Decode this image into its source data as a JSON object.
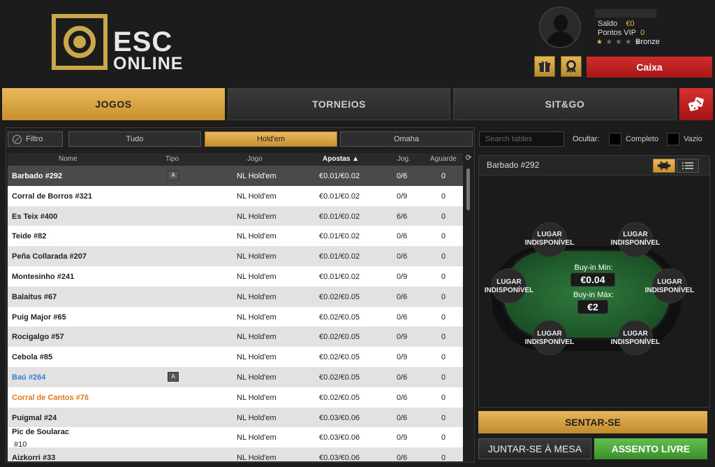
{
  "brand": {
    "line1": "ESC",
    "line2": "ONLINE"
  },
  "account": {
    "saldo_label": "Saldo",
    "saldo_value": "€0",
    "pontos_label": "Pontos VIP",
    "pontos_value": "0",
    "stars": "★ ★ ★ ★ ★",
    "tier": "Bronze",
    "caixa_label": "Caixa",
    "gift_icon": "gift-icon",
    "badge_icon": "vip-badge-icon"
  },
  "tabs": [
    {
      "label": "JOGOS"
    },
    {
      "label": "TORNEIOS"
    },
    {
      "label": "SIT&GO"
    }
  ],
  "filters": {
    "filtro_label": "Filtro",
    "types": [
      "Tudo",
      "Hold'em",
      "Omaha"
    ],
    "active_type": "Hold'em",
    "search_placeholder": "Search tables",
    "ocultar_label": "Ocultar:",
    "completo_label": "Completo",
    "vazio_label": "Vazio"
  },
  "table_list": {
    "headers": {
      "nome": "Nome",
      "tipo": "Tipo",
      "jogo": "Jogo",
      "apostas": "Apostas ▲",
      "jog": "Jog.",
      "aguarde": "Aguarde"
    },
    "rows": [
      {
        "nome": "Barbado #292",
        "locked": true,
        "jogo": "NL Hold'em",
        "apostas": "€0.01/€0.02",
        "jog": "0/6",
        "aguarde": "0",
        "selected": true
      },
      {
        "nome": "Corral de Borros #321",
        "locked": false,
        "jogo": "NL Hold'em",
        "apostas": "€0.01/€0.02",
        "jog": "0/9",
        "aguarde": "0"
      },
      {
        "nome": "Es Teix #400",
        "locked": false,
        "jogo": "NL Hold'em",
        "apostas": "€0.01/€0.02",
        "jog": "6/6",
        "aguarde": "0"
      },
      {
        "nome": "Teide #82",
        "locked": false,
        "jogo": "NL Hold'em",
        "apostas": "€0.01/€0.02",
        "jog": "0/6",
        "aguarde": "0"
      },
      {
        "nome": "Peña Collarada #207",
        "locked": false,
        "jogo": "NL Hold'em",
        "apostas": "€0.01/€0.02",
        "jog": "0/6",
        "aguarde": "0"
      },
      {
        "nome": "Montesinho #241",
        "locked": false,
        "jogo": "NL Hold'em",
        "apostas": "€0.01/€0.02",
        "jog": "0/9",
        "aguarde": "0"
      },
      {
        "nome": "Balaitus #67",
        "locked": false,
        "jogo": "NL Hold'em",
        "apostas": "€0.02/€0.05",
        "jog": "0/6",
        "aguarde": "0"
      },
      {
        "nome": "Puig Major #65",
        "locked": false,
        "jogo": "NL Hold'em",
        "apostas": "€0.02/€0.05",
        "jog": "0/6",
        "aguarde": "0"
      },
      {
        "nome": "Rocigalgo  #57",
        "locked": false,
        "jogo": "NL Hold'em",
        "apostas": "€0.02/€0.05",
        "jog": "0/9",
        "aguarde": "0"
      },
      {
        "nome": "Cebola #85",
        "locked": false,
        "jogo": "NL Hold'em",
        "apostas": "€0.02/€0.05",
        "jog": "0/9",
        "aguarde": "0"
      },
      {
        "nome": "Baú #264",
        "locked": true,
        "jogo": "NL Hold'em",
        "apostas": "€0.02/€0.05",
        "jog": "0/6",
        "aguarde": "0",
        "color": "blue"
      },
      {
        "nome": "Corral de Cantos #76",
        "locked": false,
        "jogo": "NL Hold'em",
        "apostas": "€0.02/€0.05",
        "jog": "0/6",
        "aguarde": "0",
        "color": "orange"
      },
      {
        "nome": "Puigmal #24",
        "locked": false,
        "jogo": "NL Hold'em",
        "apostas": "€0.03/€0.06",
        "jog": "0/6",
        "aguarde": "0"
      },
      {
        "nome": "Pic de Soularac",
        "nome2": "#10",
        "locked": false,
        "jogo": "NL Hold'em",
        "apostas": "€0.03/€0.06",
        "jog": "0/9",
        "aguarde": "0"
      },
      {
        "nome": "Aizkorri #33",
        "locked": false,
        "jogo": "NL Hold'em",
        "apostas": "€0.03/€0.06",
        "jog": "0/6",
        "aguarde": "0"
      }
    ]
  },
  "preview": {
    "title": "Barbado #292",
    "buyin_min_label": "Buy-in Min:",
    "buyin_min_value": "€0.04",
    "buyin_max_label": "Buy-in Máx:",
    "buyin_max_value": "€2",
    "seat_line1": "LUGAR",
    "seat_line2": "INDISPONÍVEL",
    "sentar_label": "SENTAR-SE",
    "juntar_label": "JUNTAR-SE À MESA",
    "assento_label": "ASSENTO LIVRE"
  },
  "colors": {
    "gold": "#c9a84c",
    "red": "#c62424",
    "green": "#4fa93c"
  }
}
